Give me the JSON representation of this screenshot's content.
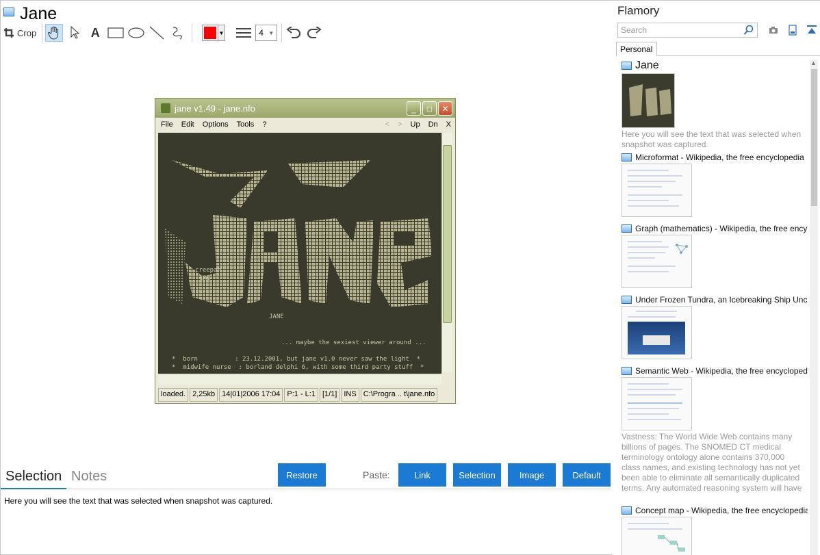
{
  "header": {
    "title": "Jane"
  },
  "toolbar": {
    "crop_label": "Crop",
    "stroke_width": "4",
    "color_hex": "#ff0000"
  },
  "snapshot": {
    "window_title": "jane v1.49 - jane.nfo",
    "menu": [
      "File",
      "Edit",
      "Options",
      "Tools",
      "?"
    ],
    "nav": [
      "<",
      ">",
      "Up",
      "Dn",
      "X"
    ],
    "status": [
      "loaded.",
      "2,25kb",
      "14|01|2006 17:04",
      "P:1 - L:1",
      "[1/1]",
      "INS",
      "C:\\Progra .. t\\jane.nfo"
    ],
    "nfo_lines": {
      "credit1": "creepah",
      "credit2": "CRO",
      "name": "JANE",
      "tagline": "... maybe the sexiest viewer around ...",
      "line1": "*  born          : 23.12.2001, but jane v1.0 never saw the light  *",
      "line2": "*  midwife nurse  : borland delphi 6, with some third party stuff  *"
    }
  },
  "bottom": {
    "tabs": [
      "Selection",
      "Notes"
    ],
    "restore_label": "Restore",
    "paste_label": "Paste:",
    "paste_buttons": [
      "Link",
      "Selection",
      "Image",
      "Default"
    ],
    "selection_text": "Here you will see the text that was selected when snapshot was captured."
  },
  "sidebar": {
    "title": "Flamory",
    "search_placeholder": "Search",
    "tab": "Personal",
    "items": [
      {
        "title": "Jane",
        "note": "Here you will see the text that was selected when snapshot was captured."
      },
      {
        "title": "Microformat - Wikipedia, the free encyclopedia"
      },
      {
        "title": "Graph (mathematics) - Wikipedia, the free ency"
      },
      {
        "title": "Under Frozen Tundra, an Icebreaking Ship Unco"
      },
      {
        "title": "Semantic Web - Wikipedia, the free encycloped",
        "note": "Vastness: The World Wide Web contains many billions of pages. The SNOMED CT medical terminology ontology alone contains 370,000 class names, and existing technology has not yet been able to eliminate all semantically duplicated terms. Any automated reasoning system will have to deal with truly huge inputs."
      },
      {
        "title": "Concept map - Wikipedia, the free encyclopedia"
      }
    ]
  }
}
